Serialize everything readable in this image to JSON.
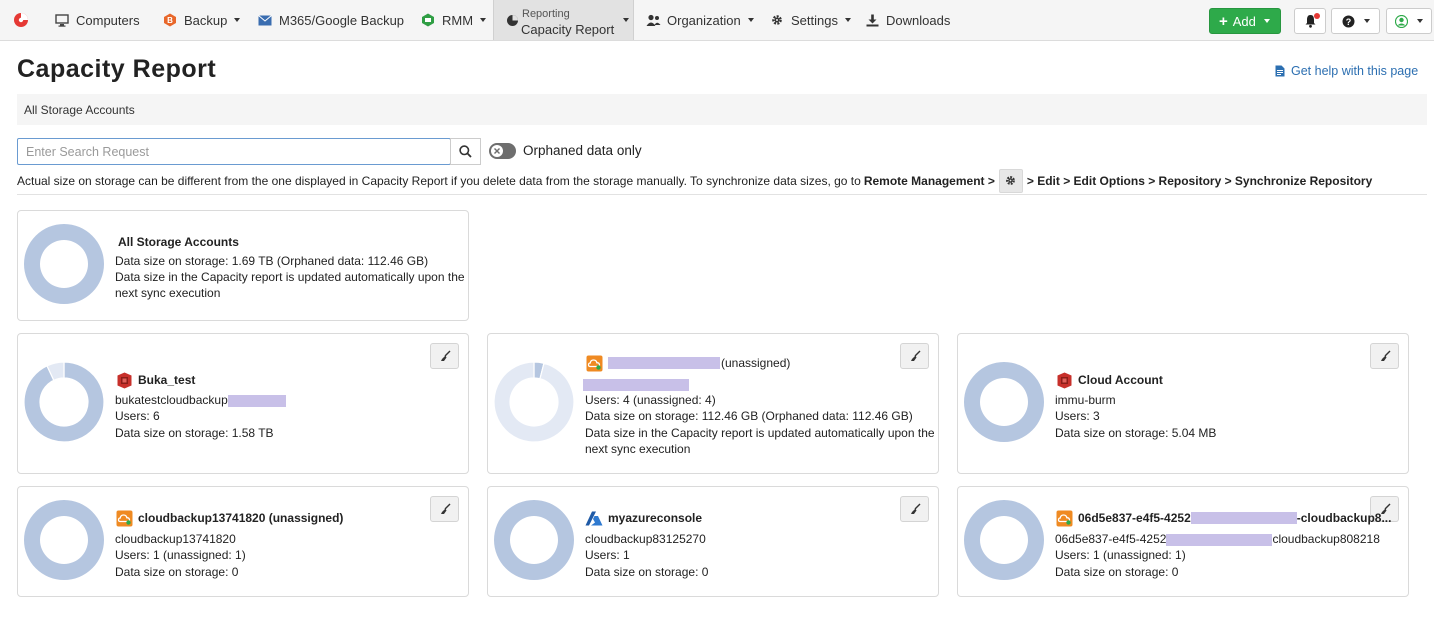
{
  "nav": {
    "computers": "Computers",
    "backup": "Backup",
    "m365": "M365/Google Backup",
    "rmm": "RMM",
    "reporting_small": "Reporting",
    "reporting_main": "Capacity Report",
    "organization": "Organization",
    "settings": "Settings",
    "downloads": "Downloads",
    "add": "Add"
  },
  "page": {
    "title": "Capacity Report",
    "help": "Get help with this page",
    "breadcrumb": "All Storage Accounts"
  },
  "search": {
    "placeholder": "Enter Search Request",
    "toggle_label": "Orphaned data only"
  },
  "notice": {
    "text": "Actual size on storage can be different from the one displayed in Capacity Report if you delete data from the storage manually. To synchronize data sizes, go to ",
    "bold1": "Remote Management >",
    "bold2": "> Edit > Edit Options > Repository > Synchronize Repository"
  },
  "summary": {
    "title": "All Storage Accounts",
    "line1": "Data size on storage: 1.69 TB (Orphaned data: 112.46 GB)",
    "line2": "Data size in the Capacity report is updated automatically upon the",
    "line3": "next sync execution"
  },
  "cards": [
    {
      "title": "Buka_test",
      "icon": "amazon-s3-icon",
      "line1": "bukatestcloudbackup",
      "line2": "Users: 6",
      "line3": "Data size on storage: 1.58 TB",
      "line4": ""
    },
    {
      "title": "(unassigned)",
      "icon": "wasabi-cloud-icon",
      "line1": "",
      "line2": "Users: 4 (unassigned: 4)",
      "line3": "Data size on storage: 112.46 GB (Orphaned data: 112.46 GB)",
      "line4": "Data size in the Capacity report is updated automatically upon the",
      "line5": "next sync execution"
    },
    {
      "title": "Cloud Account",
      "icon": "amazon-s3-icon",
      "line1": "immu-burm",
      "line2": "Users: 3",
      "line3": "Data size on storage: 5.04 MB",
      "line4": ""
    },
    {
      "title": "cloudbackup13741820 (unassigned)",
      "icon": "wasabi-cloud-icon",
      "line1": "cloudbackup13741820",
      "line2": "Users: 1 (unassigned: 1)",
      "line3": "Data size on storage: 0",
      "line4": ""
    },
    {
      "title": "myazureconsole",
      "icon": "azure-icon",
      "line1": "cloudbackup83125270",
      "line2": "Users: 1",
      "line3": "Data size on storage: 0",
      "line4": ""
    },
    {
      "title_a": "06d5e837-e4f5-4252",
      "title_b": "-cloudbackup8...",
      "icon": "wasabi-cloud-icon",
      "line1_a": "06d5e837-e4f5-4252",
      "line1_b": "cloudbackup808218",
      "line2": "Users: 1 (unassigned: 1)",
      "line3": "Data size on storage: 0",
      "line4": ""
    }
  ],
  "chart_data": [
    {
      "type": "pie",
      "name": "All Storage Accounts",
      "values": [
        100
      ],
      "colors": [
        "#b5c6e0"
      ]
    },
    {
      "type": "pie",
      "name": "Buka_test",
      "values": [
        93,
        7
      ],
      "colors": [
        "#b5c6e0",
        "#e3e9f4"
      ]
    },
    {
      "type": "pie",
      "name": "(unassigned)",
      "values": [
        4,
        96
      ],
      "colors": [
        "#b5c6e0",
        "#e3e9f4"
      ]
    },
    {
      "type": "pie",
      "name": "Cloud Account",
      "values": [
        100
      ],
      "colors": [
        "#b5c6e0"
      ]
    },
    {
      "type": "pie",
      "name": "cloudbackup13741820 (unassigned)",
      "values": [
        100
      ],
      "colors": [
        "#b5c6e0"
      ]
    },
    {
      "type": "pie",
      "name": "myazureconsole",
      "values": [
        100
      ],
      "colors": [
        "#b5c6e0"
      ]
    },
    {
      "type": "pie",
      "name": "06d5e837-e4f5-4252",
      "values": [
        100
      ],
      "colors": [
        "#b5c6e0"
      ]
    }
  ],
  "colors": {
    "accent_green": "#2eaa4a",
    "link_blue": "#2c6fb1",
    "donut_fill": "#b5c6e0",
    "donut_rest": "#e3e9f4"
  }
}
